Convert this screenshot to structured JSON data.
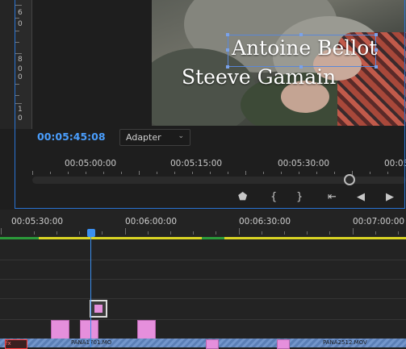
{
  "monitor": {
    "ruler_labels": [
      "6",
      "0",
      "0",
      "8",
      "0",
      "0",
      "1",
      "0"
    ],
    "title_line1": "Antoine Bellot",
    "title_line2": "Steeve Gamain",
    "timecode": "00:05:45:08",
    "fit_value": "Adapter",
    "ruler_times": [
      "00:05:00:00",
      "00:05:15:00",
      "00:05:30:00",
      "00:05"
    ],
    "scrub_position": 0.85,
    "transport": {
      "marker": "marker-icon",
      "in": "mark-in-icon",
      "out": "mark-out-icon",
      "goto_in": "go-to-in-icon",
      "step_back": "step-back-icon",
      "play": "play-icon"
    }
  },
  "timeline": {
    "ruler_times": [
      "00:05:30:00",
      "00:06:00:00",
      "00:06:30:00",
      "00:07:00:00"
    ],
    "video_clip_label_1": "PANA1701.MO",
    "video_clip_label_2": "PANA2512.MOV",
    "clip_badge": "fx"
  },
  "colors": {
    "accent": "#3b8ff0",
    "timecode": "#4a9fff",
    "clip_pink": "#e58fdc",
    "workarea": "#d9d424",
    "video_track": "#5b7fb6"
  }
}
